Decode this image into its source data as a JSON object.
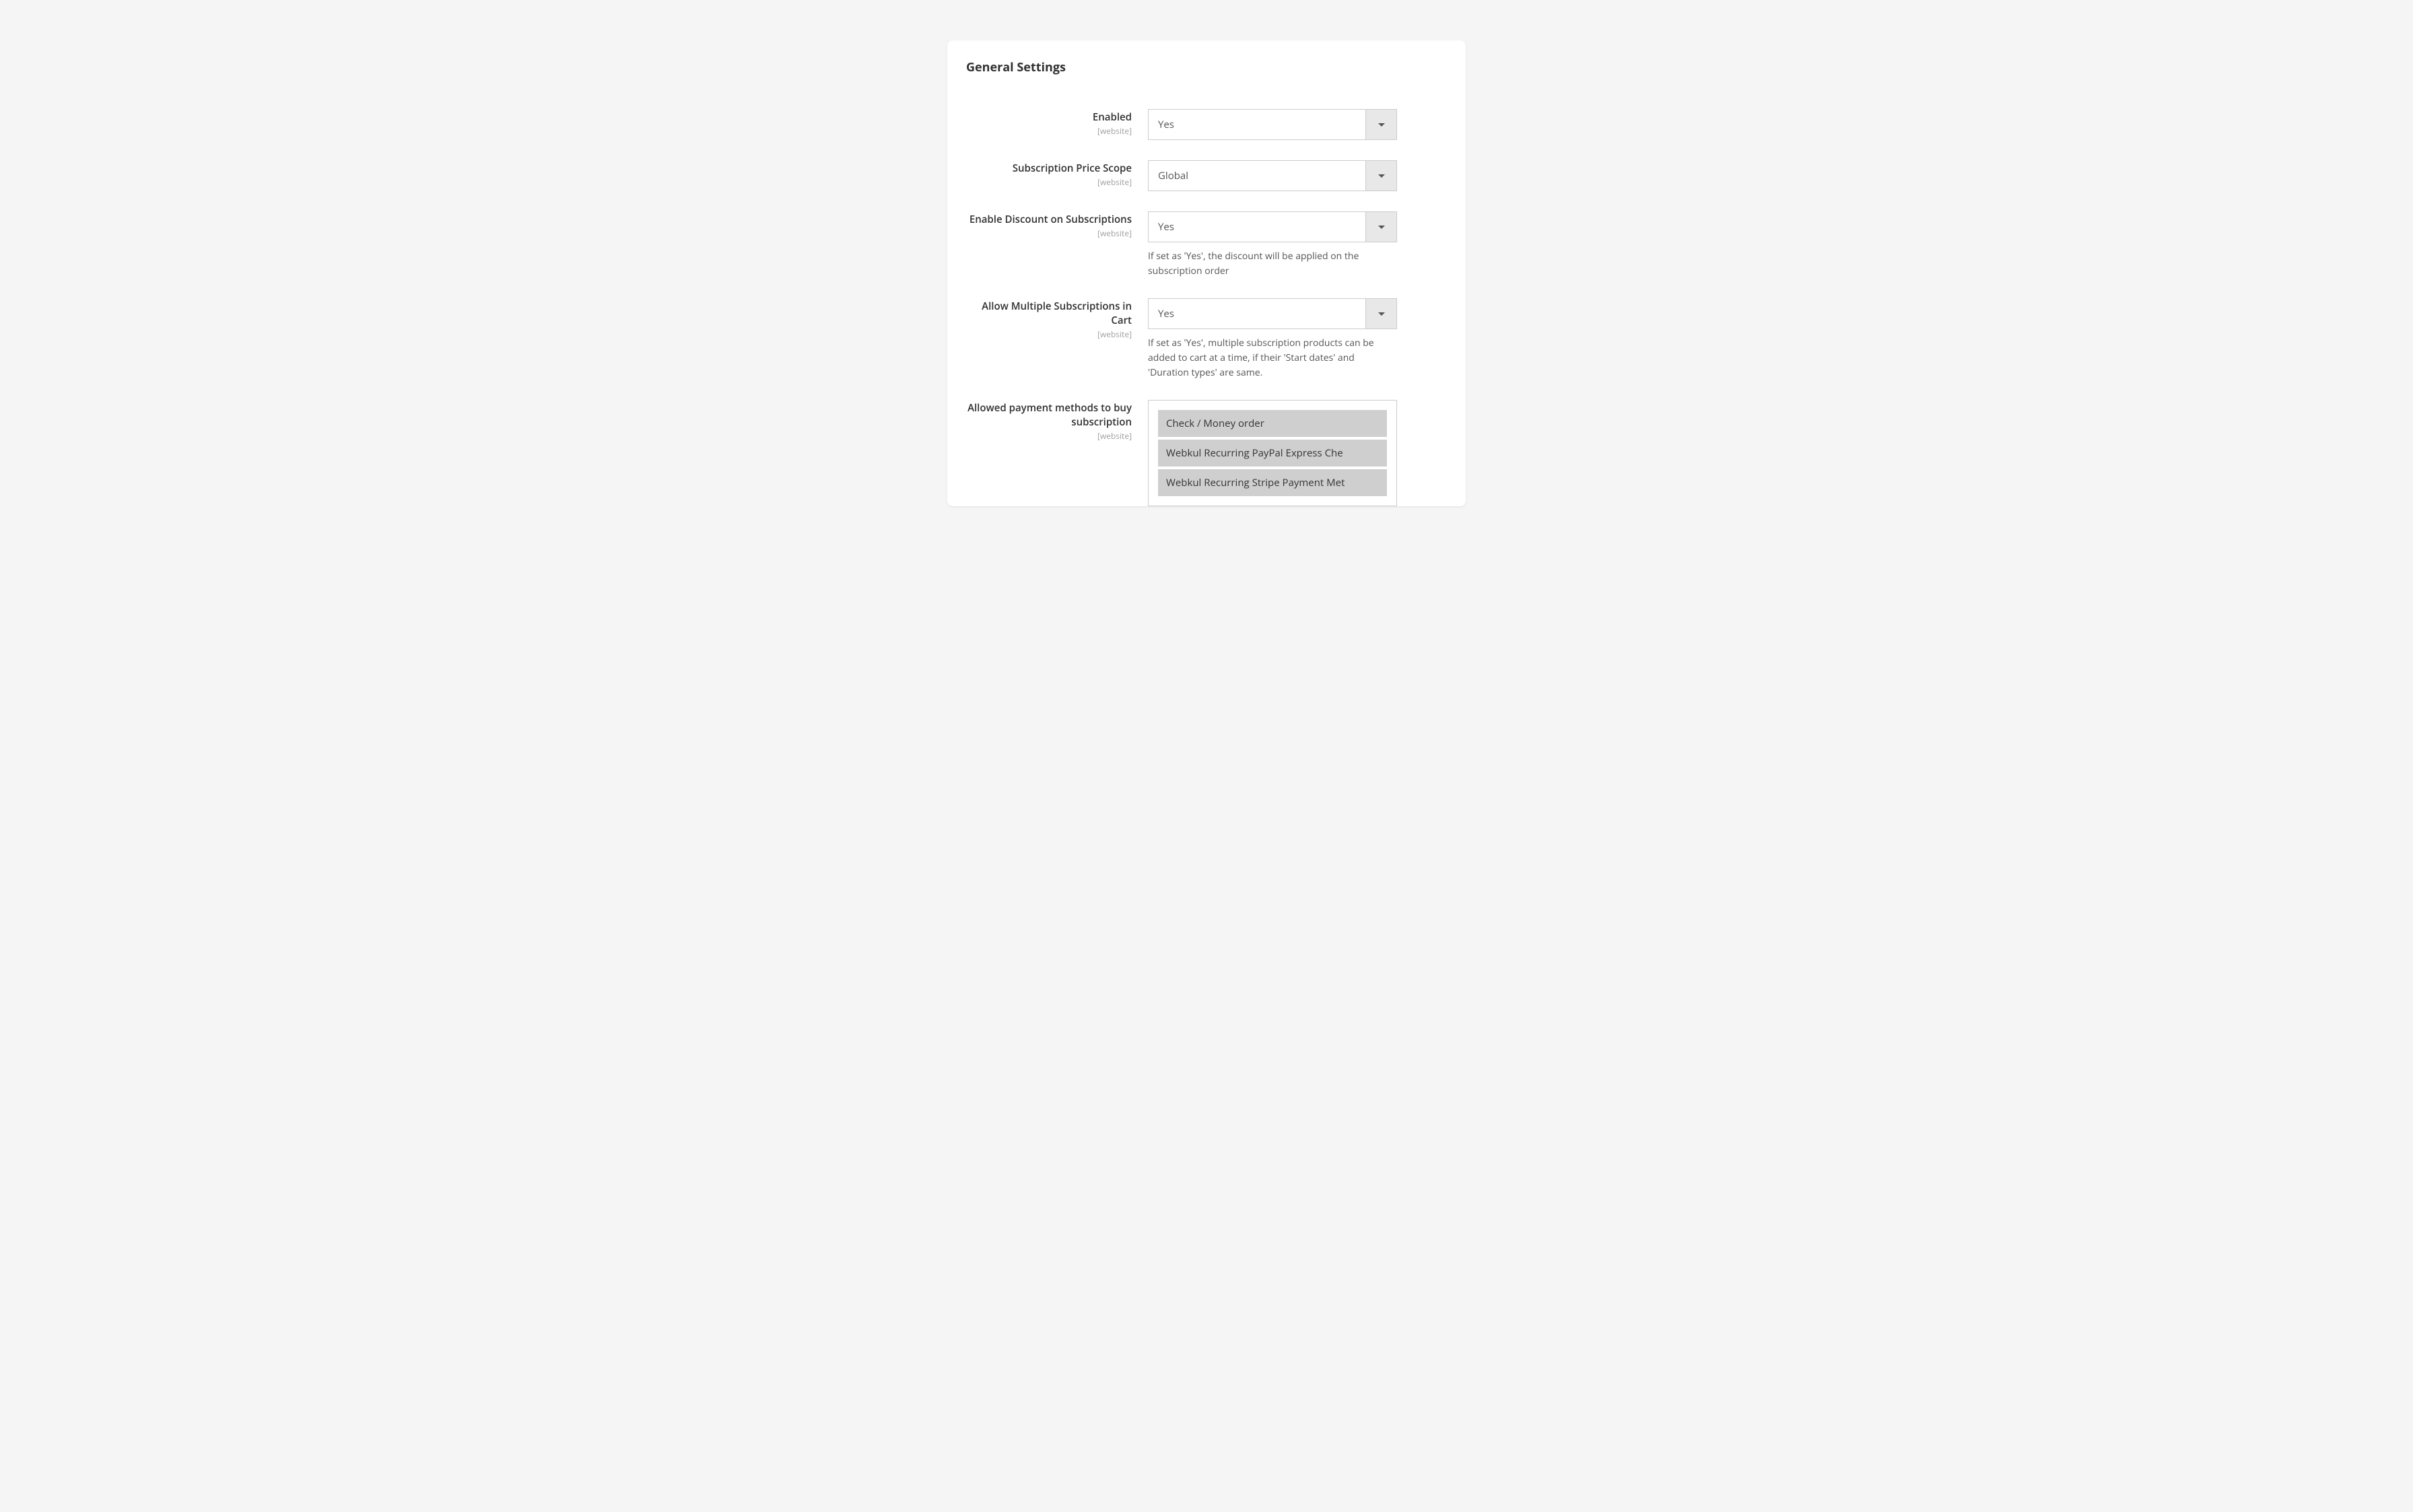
{
  "section_title": "General Settings",
  "scope_label": "[website]",
  "fields": {
    "enabled": {
      "label": "Enabled",
      "value": "Yes"
    },
    "price_scope": {
      "label": "Subscription Price Scope",
      "value": "Global"
    },
    "enable_discount": {
      "label": "Enable Discount on Subscriptions",
      "value": "Yes",
      "help": "If set as 'Yes', the discount will be applied on the subscription order"
    },
    "multiple_subs": {
      "label": "Allow Multiple Subscriptions in Cart",
      "value": "Yes",
      "help": "If set as 'Yes', multiple subscription products can be added to cart at a time, if their 'Start dates' and 'Duration types' are same."
    },
    "payment_methods": {
      "label": "Allowed payment methods to buy subscription",
      "options": [
        "Check / Money order",
        "Webkul Recurring PayPal Express Che",
        "Webkul Recurring Stripe Payment Met"
      ]
    }
  }
}
